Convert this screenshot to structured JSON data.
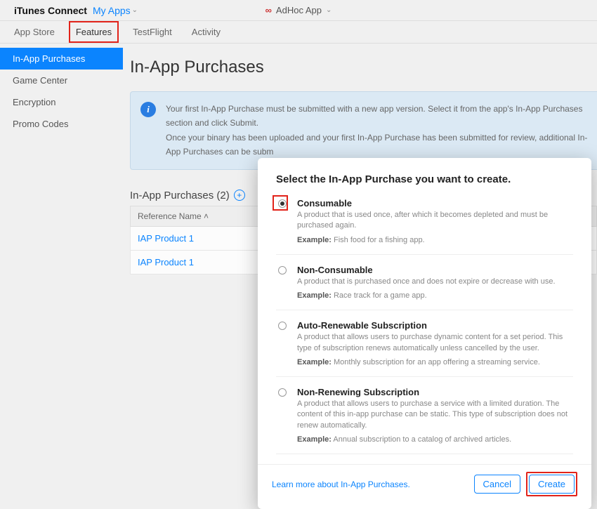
{
  "header": {
    "brand": "iTunes Connect",
    "myapps": "My Apps",
    "adhoc": "AdHoc App"
  },
  "tabs": {
    "appstore": "App Store",
    "features": "Features",
    "testflight": "TestFlight",
    "activity": "Activity"
  },
  "sidebar": {
    "items": [
      "In-App Purchases",
      "Game Center",
      "Encryption",
      "Promo Codes"
    ]
  },
  "page": {
    "title": "In-App Purchases",
    "info_line1": "Your first In-App Purchase must be submitted with a new app version. Select it from the app's In-App Purchases section and click Submit.",
    "info_line2": "Once your binary has been uploaded and your first In-App Purchase has been submitted for review, additional In-App Purchases can be subm",
    "subheading": "In-App Purchases (2)",
    "col_refname": "Reference Name ˄",
    "rows": [
      "IAP Product 1",
      "IAP Product 1"
    ]
  },
  "modal": {
    "heading": "Select the In-App Purchase you want to create.",
    "options": [
      {
        "title": "Consumable",
        "desc": "A product that is used once, after which it becomes depleted and must be purchased again.",
        "example_label": "Example:",
        "example": "Fish food for a fishing app."
      },
      {
        "title": "Non-Consumable",
        "desc": "A product that is purchased once and does not expire or decrease with use.",
        "example_label": "Example:",
        "example": "Race track for a game app."
      },
      {
        "title": "Auto-Renewable Subscription",
        "desc": "A product that allows users to purchase dynamic content for a set period. This type of subscription renews automatically unless cancelled by the user.",
        "example_label": "Example:",
        "example": "Monthly subscription for an app offering a streaming service."
      },
      {
        "title": "Non-Renewing Subscription",
        "desc": "A product that allows users to purchase a service with a limited duration. The content of this in-app purchase can be static. This type of subscription does not renew automatically.",
        "example_label": "Example:",
        "example": "Annual subscription to a catalog of archived articles."
      }
    ],
    "learn_more": "Learn more about In-App Purchases.",
    "cancel": "Cancel",
    "create": "Create"
  }
}
